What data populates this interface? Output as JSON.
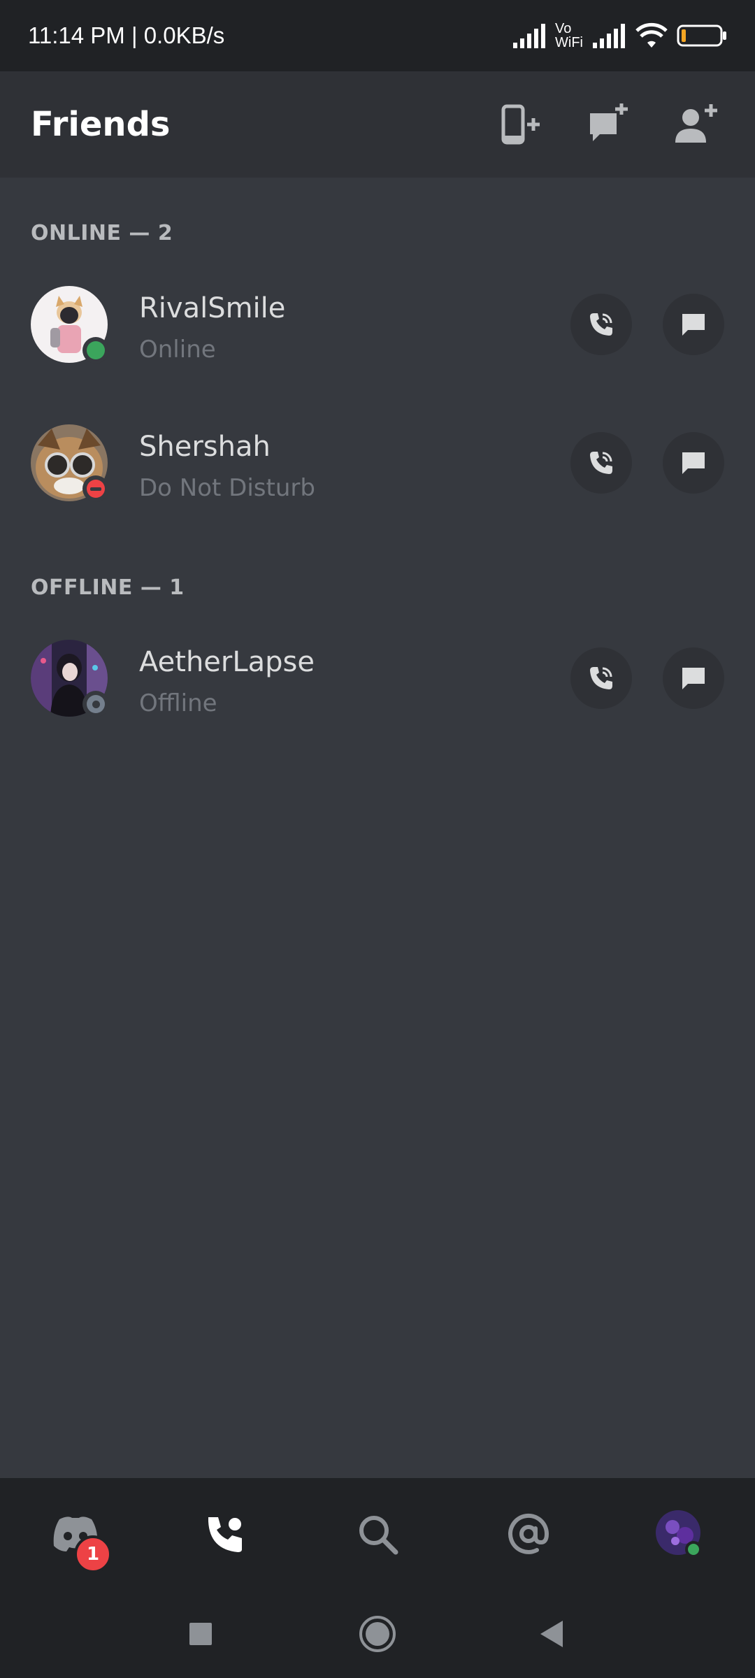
{
  "status_bar": {
    "time": "11:14 PM | 0.0KB/s",
    "wifi_label_top": "Vo",
    "wifi_label_bottom": "WiFi"
  },
  "header": {
    "title": "Friends"
  },
  "sections": {
    "online_label": "ONLINE — 2",
    "offline_label": "OFFLINE — 1"
  },
  "friends": [
    {
      "name": "RivalSmile",
      "status": "Online",
      "presence": "online"
    },
    {
      "name": "Shershah",
      "status": "Do Not Disturb",
      "presence": "dnd"
    },
    {
      "name": "AetherLapse",
      "status": "Offline",
      "presence": "offline"
    }
  ],
  "bottom_nav": {
    "home_badge": "1"
  },
  "colors": {
    "online": "#3ba55c",
    "dnd": "#ed4245",
    "offline": "#747f8d",
    "background": "#36393f",
    "header": "#2f3136",
    "nav": "#202225"
  }
}
